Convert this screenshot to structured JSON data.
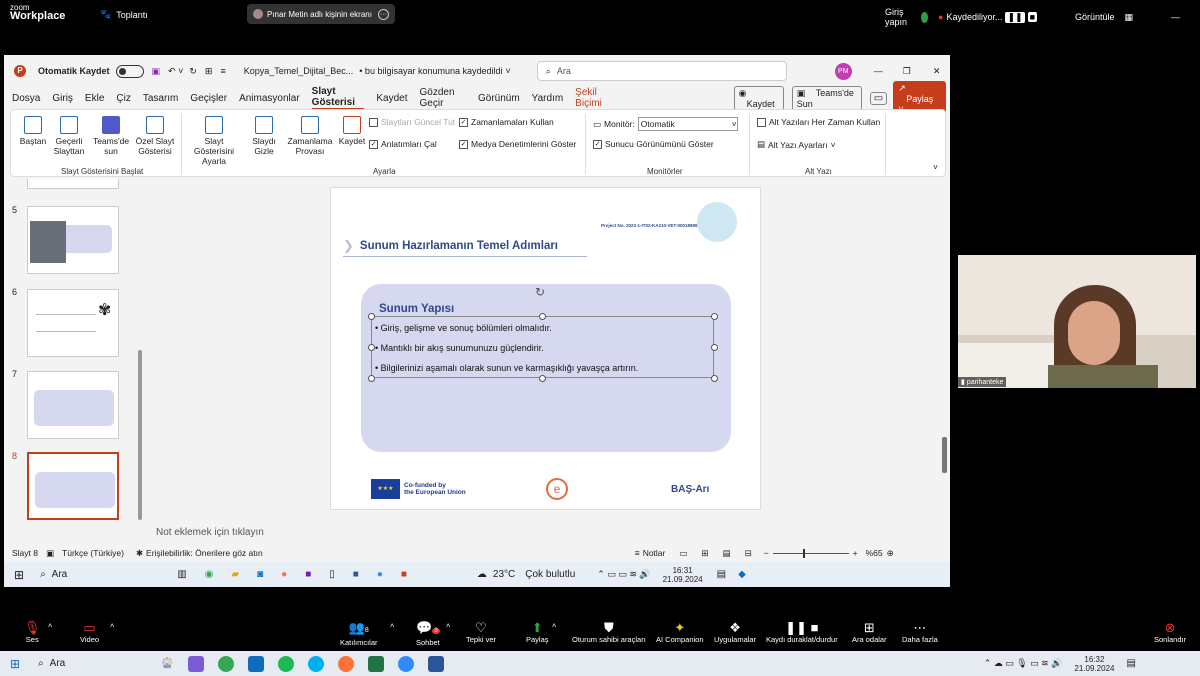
{
  "zoom_top": {
    "logo_line1": "zoom",
    "logo_line2": "Workplace",
    "meeting": "Toplantı",
    "share_label": "Pınar Metin adlı kişinin ekranı",
    "signin": "Giriş yapın",
    "recording": "Kaydediliyor...",
    "view": "Görüntüle"
  },
  "ppt": {
    "autosave": "Otomatik Kaydet",
    "filename": "Kopya_Temel_Dijital_Bec...",
    "save_status": "• bu bilgisayar konumuna kaydedildi",
    "search_placeholder": "Ara",
    "avatar": "PM",
    "menu": [
      "Dosya",
      "Giriş",
      "Ekle",
      "Çiz",
      "Tasarım",
      "Geçişler",
      "Animasyonlar",
      "Slayt Gösterisi",
      "Kaydet",
      "Gözden Geçir",
      "Görünüm",
      "Yardım",
      "Şekil Biçimi"
    ],
    "menu_right": {
      "kaydet": "Kaydet",
      "teams": "Teams'de Sun",
      "paylas": "Paylaş"
    },
    "ribbon": {
      "bastan": "Baştan",
      "gecerli": "Geçerli Slayttan",
      "teams_sun": "Teams'de sun",
      "ozel": "Özel Slayt Gösterisi",
      "group1": "Slayt Gösterisini Başlat",
      "ayarla": "Slayt Gösterisini Ayarla",
      "gizle": "Slaydı Gizle",
      "zamanlama": "Zamanlama Provası",
      "kaydet": "Kaydet",
      "cb_guncel": "Slaytları Güncel Tut",
      "cb_anlatim": "Anlatımları Çal",
      "cb_zaman": "Zamanlamaları Kullan",
      "cb_medya": "Medya Denetimlerini Göster",
      "group2": "Ayarla",
      "monitor_label": "Monitör:",
      "monitor_value": "Otomatik",
      "sunucu": "Sunucu Görünümünü Göster",
      "group3": "Monitörler",
      "alt_yazi": "Alt Yazıları Her Zaman Kullan",
      "alt_ayar": "Alt Yazı Ayarları",
      "group4": "Alt Yazı"
    },
    "thumbs": [
      "5",
      "6",
      "7",
      "8"
    ],
    "slide": {
      "project": "Project No. 2023-1-IT02-KA210-VET-000189993",
      "title": "Sunum Hazırlamanın Temel Adımları",
      "box_title": "Sunum Yapısı",
      "bullets": [
        "Giriş, gelişme ve sonuç bölümleri olmalıdır.",
        "Mantıklı bir akış sunumunuzu güçlendirir.",
        "Bilgilerinizi aşamalı olarak sunun ve karmaşıklığı yavaşça artırın."
      ],
      "eu_line1": "Co-funded by",
      "eu_line2": "the European Union",
      "bas": "BAŞ-Arı"
    },
    "notes": "Not eklemek için tıklayın",
    "status": {
      "slide": "Slayt 8",
      "lang": "Türkçe (Türkiye)",
      "access": "Erişilebilirlik: Önerilere göz atın",
      "notlar": "Notlar",
      "zoom": "%65"
    },
    "inner_taskbar": {
      "search": "Ara",
      "weather": "23°C",
      "weather_text": "Çok bulutlu",
      "time": "16:31",
      "date": "21.09.2024"
    }
  },
  "video": {
    "name": "parihanteke"
  },
  "zoom_bottom": {
    "ses": "Ses",
    "video": "Video",
    "participants_count": "8",
    "katilimcilar": "Katılımcılar",
    "chat_badge": "3",
    "sohbet": "Sohbet",
    "tepki": "Tepki ver",
    "paylas": "Paylaş",
    "host_tools": "Oturum sahibi araçları",
    "companion": "AI Companion",
    "apps": "Uygulamalar",
    "record": "Kaydı duraklat/durdur",
    "rooms": "Ara odalar",
    "more": "Daha fazla",
    "end": "Sonlandır"
  },
  "win_taskbar": {
    "search": "Ara",
    "time": "16:32",
    "date": "21.09.2024"
  }
}
